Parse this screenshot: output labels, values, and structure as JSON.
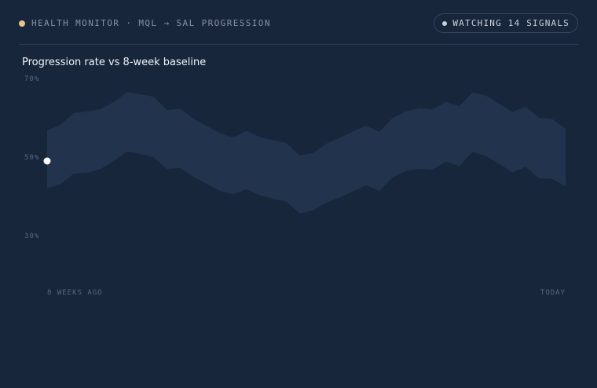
{
  "header": {
    "title": "HEALTH MONITOR · MQL → SAL PROGRESSION",
    "status_color": "#e6c589",
    "signals_label": "WATCHING 14 SIGNALS",
    "signals_dot_color": "#c9d1dc"
  },
  "chart_data": {
    "type": "area",
    "title": "Progression rate vs 8-week baseline",
    "xlabel": "",
    "ylabel": "",
    "ylim": [
      20,
      70
    ],
    "yticks": [
      70,
      50,
      30
    ],
    "ytick_labels": [
      "70%",
      "50%",
      "30%"
    ],
    "x_start_label": "8 WEEKS AGO",
    "x_end_label": "TODAY",
    "grid": false,
    "band_color": "#22334d",
    "marker_color": "#ffffff",
    "series": [
      {
        "upper": [
          56.8,
          58.2,
          61.2,
          61.6,
          62.2,
          64.0,
          66.5,
          66.0,
          65.4,
          62.0,
          62.3,
          59.8,
          57.9,
          56.1,
          55.0,
          56.7,
          55.1,
          54.3,
          53.6,
          50.4,
          51.0,
          53.4,
          54.9,
          56.5,
          58.0,
          56.4,
          60.0,
          61.6,
          62.4,
          62.1,
          64.1,
          63.0,
          66.4,
          65.7,
          63.6,
          61.5,
          62.8,
          60.0,
          59.7,
          57.2
        ],
        "lower": [
          42.1,
          43.1,
          45.8,
          46.0,
          46.9,
          49.0,
          51.4,
          50.8,
          50.0,
          47.0,
          47.2,
          45.0,
          43.2,
          41.4,
          40.5,
          41.8,
          40.3,
          39.4,
          38.7,
          35.6,
          36.4,
          38.4,
          39.7,
          41.3,
          42.8,
          41.4,
          44.8,
          46.5,
          47.0,
          46.8,
          48.9,
          47.7,
          51.3,
          50.3,
          48.3,
          46.1,
          47.5,
          44.6,
          44.4,
          42.6
        ]
      }
    ],
    "current_value": 49.0
  }
}
